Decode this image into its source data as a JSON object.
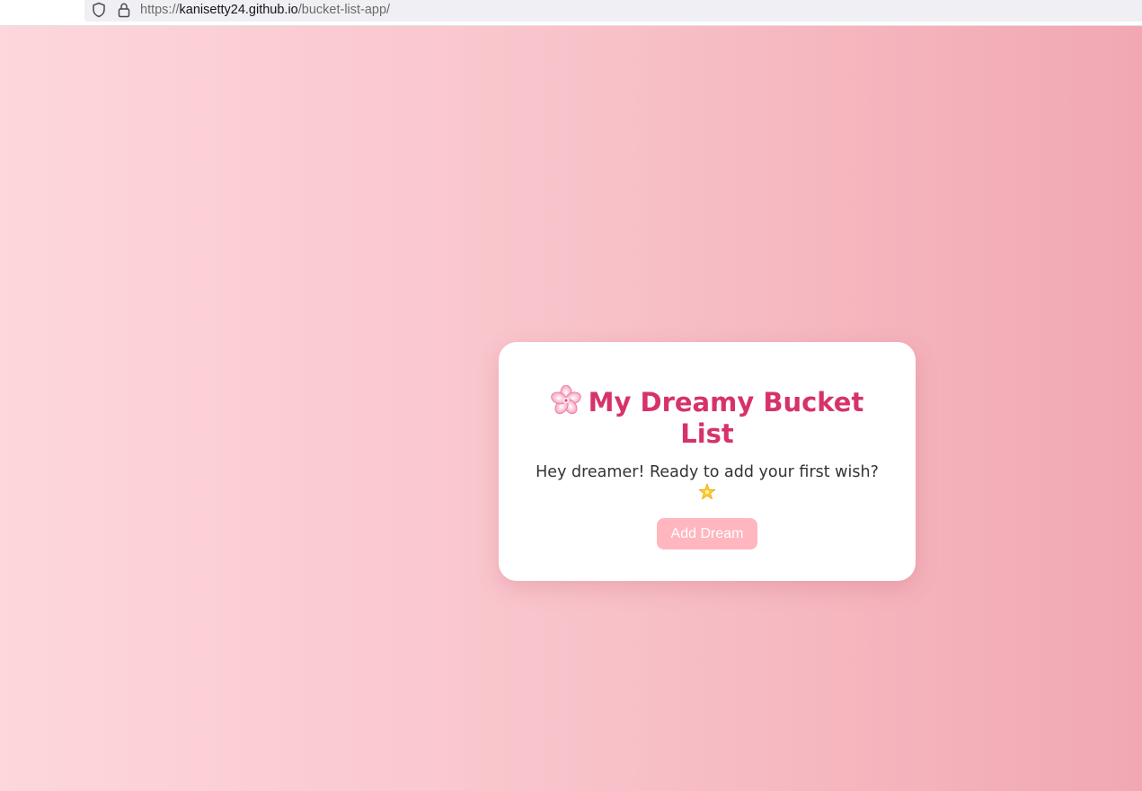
{
  "browser": {
    "url_scheme": "https://",
    "url_host": "kanisetty24.github.io",
    "url_path": "/bucket-list-app/"
  },
  "card": {
    "title": "My Dreamy Bucket List",
    "title_icon": "cherry-blossom-icon",
    "subtitle": "Hey dreamer! Ready to add your first wish?",
    "subtitle_icon": "glowing-star-icon",
    "add_button_label": "Add Dream"
  },
  "colors": {
    "title": "#d63368",
    "button": "#ffb6bf",
    "gradient_start": "#fdd7dc",
    "gradient_end": "#f1a8b2"
  }
}
